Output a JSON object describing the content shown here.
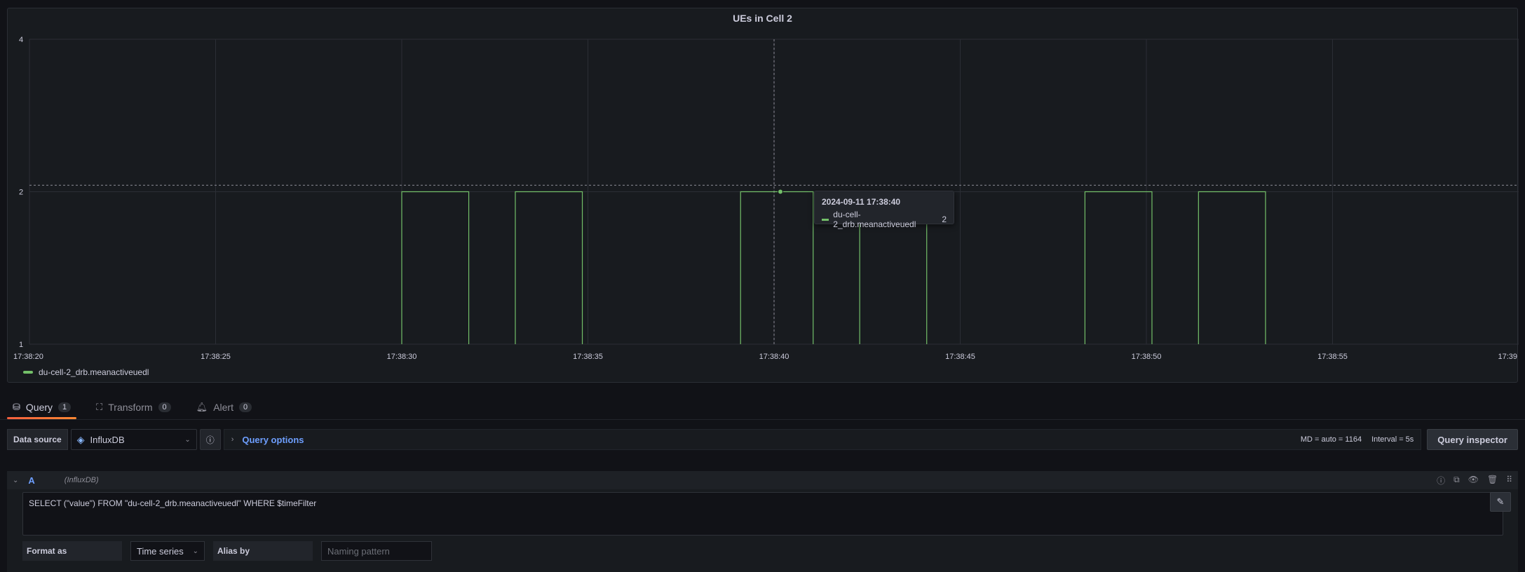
{
  "panel": {
    "title": "UEs in Cell 2",
    "legend_label": "du-cell-2_drb.meanactiveuedl",
    "tooltip": {
      "time": "2024-09-11 17:38:40",
      "series": "du-cell-2_drb.meanactiveuedl",
      "value": "2"
    }
  },
  "chart_data": {
    "type": "line",
    "title": "UEs in Cell 2",
    "xlabel": "",
    "ylabel": "",
    "ylim": [
      1,
      4
    ],
    "yscale": "log",
    "yticks": [
      "1",
      "2",
      "4"
    ],
    "xticks": [
      "17:38:20",
      "17:38:25",
      "17:38:30",
      "17:38:35",
      "17:38:40",
      "17:38:45",
      "17:38:50",
      "17:38:55",
      "17:39"
    ],
    "xlim_seconds": [
      20,
      60
    ],
    "grid": true,
    "legend": "bottom-left",
    "series": [
      {
        "name": "du-cell-2_drb.meanactiveuedl",
        "color": "#73bf69",
        "step_segments_seconds": [
          [
            30,
            31.8
          ],
          [
            33.05,
            34.85
          ],
          [
            39.1,
            41.05
          ],
          [
            42.3,
            44.1
          ],
          [
            48.35,
            50.15
          ],
          [
            51.4,
            53.2
          ]
        ],
        "high_value": 2,
        "low_value": 1
      }
    ],
    "cursor_x_seconds": 40,
    "threshold_line_value": 2.06
  },
  "tabs": [
    {
      "label": "Query",
      "count": "1",
      "icon": "database-icon",
      "active": true
    },
    {
      "label": "Transform",
      "count": "0",
      "icon": "transform-icon",
      "active": false
    },
    {
      "label": "Alert",
      "count": "0",
      "icon": "bell-icon",
      "active": false
    }
  ],
  "datasource": {
    "label": "Data source",
    "selected": "InfluxDB",
    "query_options": "Query options",
    "md": "MD = auto = 1164",
    "interval": "Interval = 5s",
    "inspector": "Query inspector"
  },
  "query": {
    "letter": "A",
    "datasource": "(InfluxDB)",
    "text": "SELECT (\"value\") FROM \"du-cell-2_drb.meanactiveuedl\" WHERE $timeFilter",
    "format_label": "Format as",
    "format_value": "Time series",
    "alias_label": "Alias by",
    "alias_placeholder": "Naming pattern"
  }
}
